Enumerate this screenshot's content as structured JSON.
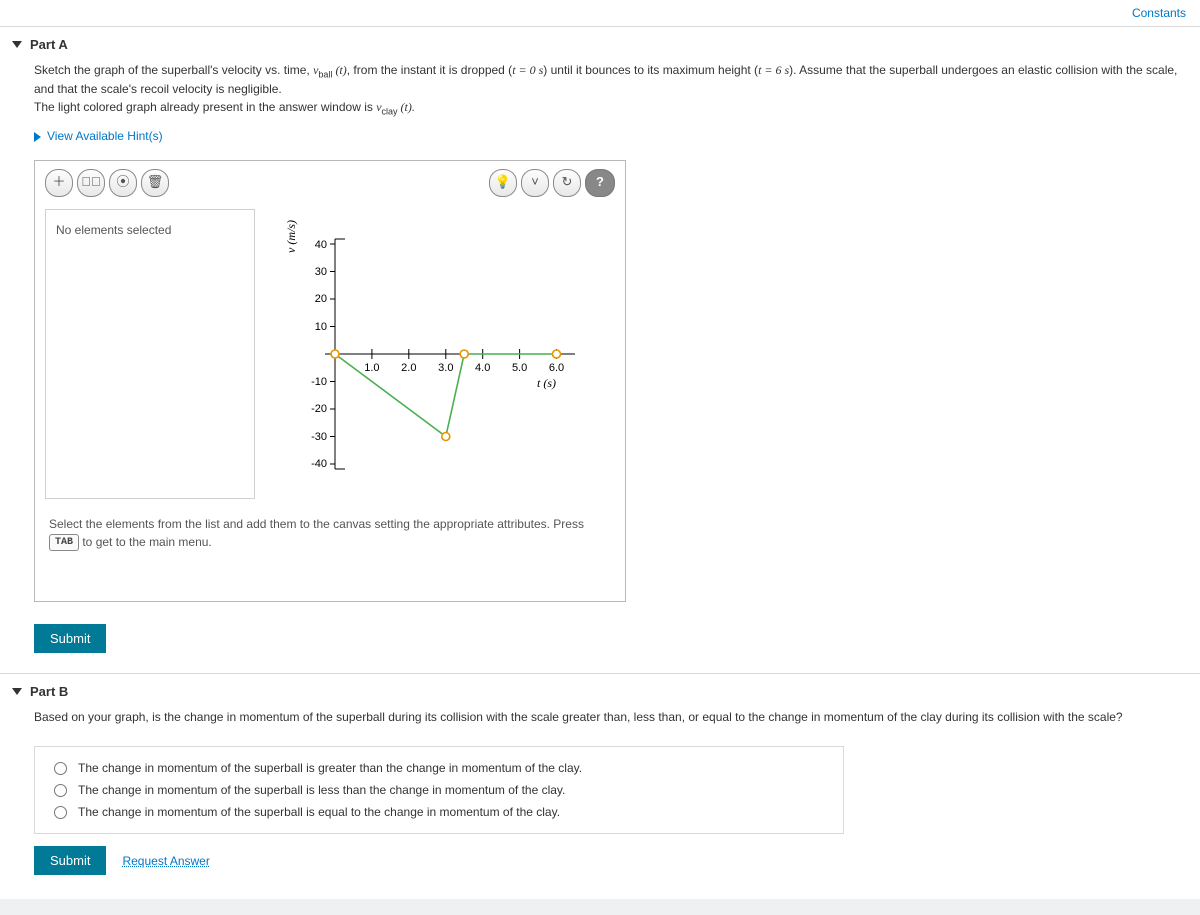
{
  "constants_link": "Constants",
  "partA": {
    "title": "Part A",
    "instruction_pre": "Sketch the graph of the superball's velocity vs. time, ",
    "vball": "v",
    "vball_sub": "ball",
    "oft": " (t)",
    "instruction_mid": ", from the instant it is dropped (",
    "t0": "t = 0 s",
    "instruction_mid2": ") until it bounces to its maximum height (",
    "t6": "t = 6 s",
    "instruction_mid3": "). Assume that the superball undergoes an elastic collision with the scale, and that the scale's recoil velocity is negligible.",
    "line2_pre": "The light colored graph already present in the answer window is ",
    "vclay": "v",
    "vclay_sub": "clay",
    "line2_post": " (t).",
    "hints": "View Available Hint(s)",
    "no_elements": "No elements selected",
    "yaxis_label": "v (m/s)",
    "xaxis_label": "t (s)",
    "instruction_text_pre": "Select the elements from the list and add them to the canvas setting the appropriate attributes. Press ",
    "tab_key": "TAB",
    "instruction_text_post": " to get to the main menu.",
    "submit": "Submit"
  },
  "partB": {
    "title": "Part B",
    "question": "Based on your graph, is the change in momentum of the superball during its collision with the scale greater than, less than, or equal to the change in momentum of the clay during its collision with the scale?",
    "opt1": "The change in momentum of the superball is greater than the change in momentum of the clay.",
    "opt2": "The change in momentum of the superball is less than the change in momentum of the clay.",
    "opt3": "The change in momentum of the superball is equal to the change in momentum of the clay.",
    "submit": "Submit",
    "request": "Request Answer"
  },
  "chart_data": {
    "type": "line",
    "xlabel": "t (s)",
    "ylabel": "v (m/s)",
    "xlim": [
      0,
      6.5
    ],
    "ylim": [
      -40,
      40
    ],
    "xticks": [
      1.0,
      2.0,
      3.0,
      4.0,
      5.0,
      6.0
    ],
    "yticks": [
      -40,
      -30,
      -20,
      -10,
      10,
      20,
      30,
      40
    ],
    "series": [
      {
        "name": "v_clay",
        "color": "#4caf50",
        "points": [
          {
            "t": 0.0,
            "v": 0.0
          },
          {
            "t": 3.0,
            "v": -30.0
          },
          {
            "t": 3.5,
            "v": 0.0
          },
          {
            "t": 6.0,
            "v": 0.0
          }
        ],
        "markers_at": [
          0.0,
          3.0,
          3.5,
          6.0
        ]
      }
    ]
  }
}
